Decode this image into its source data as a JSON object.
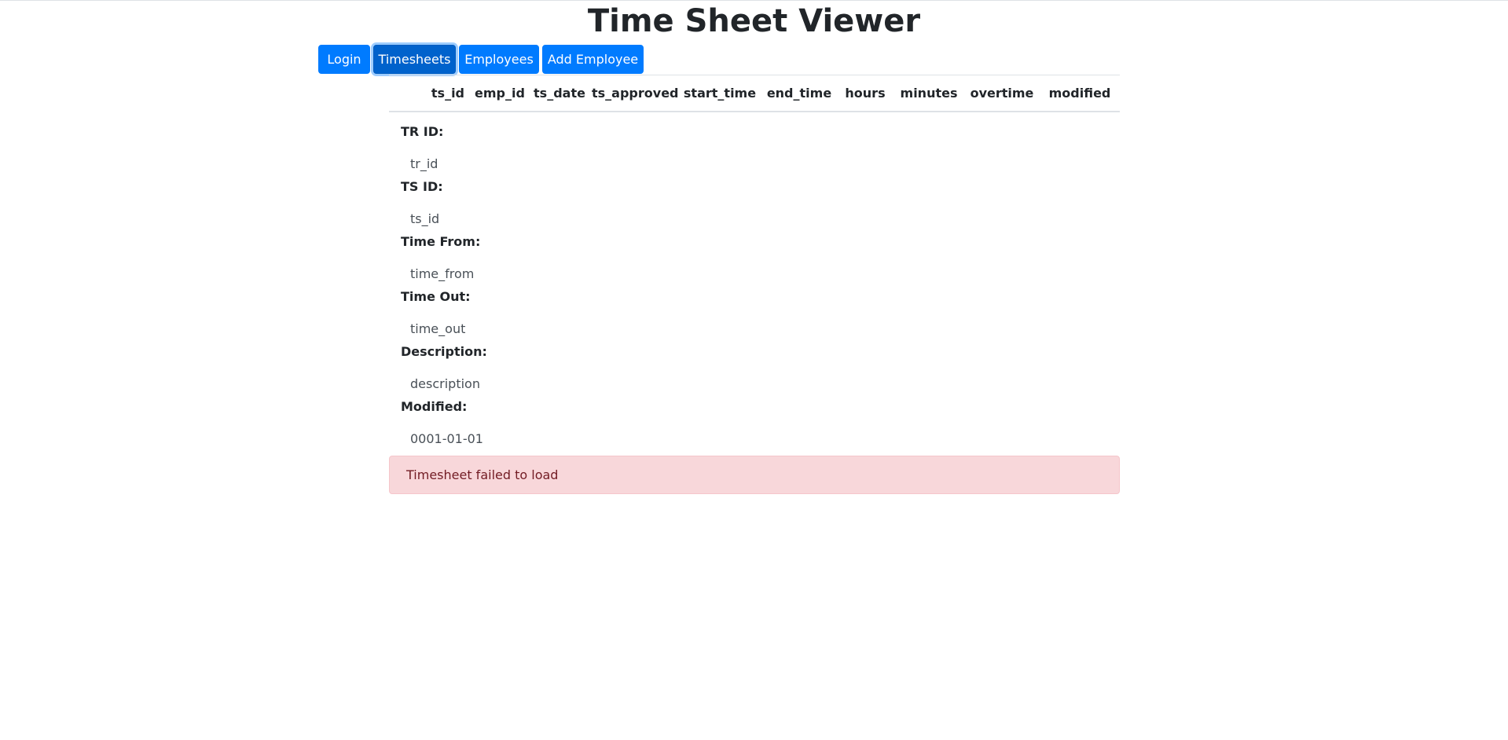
{
  "header": {
    "title": "Time Sheet Viewer"
  },
  "nav": {
    "login": "Login",
    "timesheets": "Timesheets",
    "employees": "Employees",
    "add_employee": "Add Employee",
    "active": "timesheets"
  },
  "table": {
    "columns": [
      "ts_id",
      "emp_id",
      "ts_date",
      "ts_approved",
      "start_time",
      "end_time",
      "hours",
      "minutes",
      "overtime",
      "modified"
    ]
  },
  "details": {
    "tr_id": {
      "label": "TR ID:",
      "value": "tr_id"
    },
    "ts_id": {
      "label": "TS ID:",
      "value": "ts_id"
    },
    "time_from": {
      "label": "Time From:",
      "value": "time_from"
    },
    "time_out": {
      "label": "Time Out:",
      "value": "time_out"
    },
    "description": {
      "label": "Description:",
      "value": "description"
    },
    "modified": {
      "label": "Modified:",
      "value": "0001-01-01"
    }
  },
  "alert": {
    "message": "Timesheet failed to load"
  },
  "colors": {
    "primary": "#007bff",
    "primary_active": "#0062cc",
    "danger_bg": "#f8d7da",
    "danger_text": "#721c24"
  }
}
